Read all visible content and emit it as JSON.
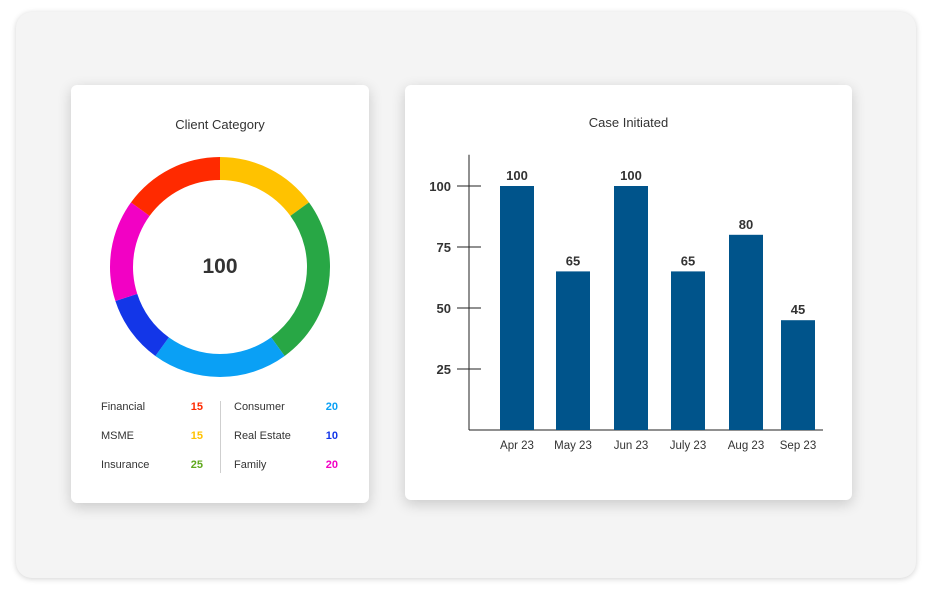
{
  "chart_data": [
    {
      "type": "pie",
      "title": "Client Category",
      "center_label": "100",
      "categories": [
        "Financial",
        "MSME",
        "Insurance",
        "Consumer",
        "Real Estate",
        "Family"
      ],
      "values": [
        15,
        15,
        25,
        20,
        10,
        20
      ],
      "colors": [
        "#ff2a00",
        "#ffc200",
        "#5fa81c",
        "#0aa0f5",
        "#1336e8",
        "#f201c4"
      ],
      "ring_colors": [
        "#ffc200",
        "#28a745",
        "#0aa0f5",
        "#1336e8",
        "#f201c4",
        "#ff2a00"
      ],
      "ring_values": [
        15,
        25,
        20,
        10,
        15,
        15
      ]
    },
    {
      "type": "bar",
      "title": "Case Initiated",
      "categories": [
        "Apr 23",
        "May 23",
        "Jun 23",
        "July 23",
        "Aug 23",
        "Sep 23"
      ],
      "values": [
        100,
        65,
        100,
        65,
        80,
        45
      ],
      "yticks": [
        25,
        50,
        75,
        100
      ],
      "color": "#00548b",
      "xlabel": "",
      "ylabel": ""
    }
  ]
}
